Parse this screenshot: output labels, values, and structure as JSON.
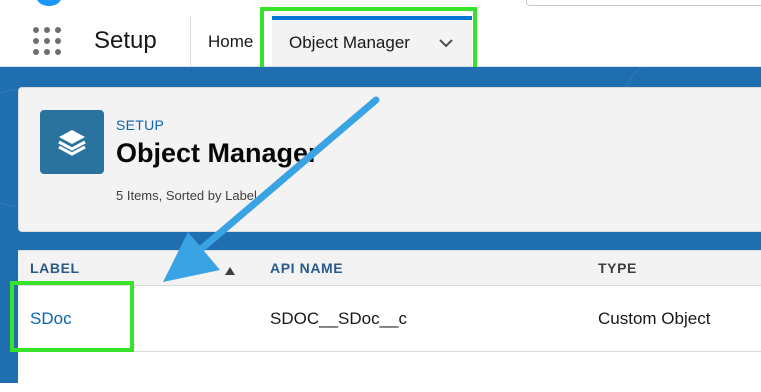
{
  "nav": {
    "app_name": "Setup",
    "home_label": "Home",
    "active_tab_label": "Object Manager"
  },
  "header": {
    "breadcrumb": "SETUP",
    "title": "Object Manager",
    "meta": "5 Items, Sorted by Label"
  },
  "table": {
    "columns": [
      "LABEL",
      "API NAME",
      "TYPE"
    ],
    "rows": [
      {
        "label": "SDoc",
        "api_name": "SDOC__SDoc__c",
        "type": "Custom Object"
      }
    ]
  },
  "icons": {
    "app_launcher": "app-launcher-grid-icon",
    "tab_chevron": "chevron-down-icon",
    "object_icon": "layers-icon",
    "sort": "sort-ascending-icon"
  },
  "colors": {
    "brand_blue": "#1f6fb0",
    "link_blue": "#0b63b5",
    "highlight_green": "#39e22a",
    "annotation_arrow": "#3aa3e3"
  }
}
